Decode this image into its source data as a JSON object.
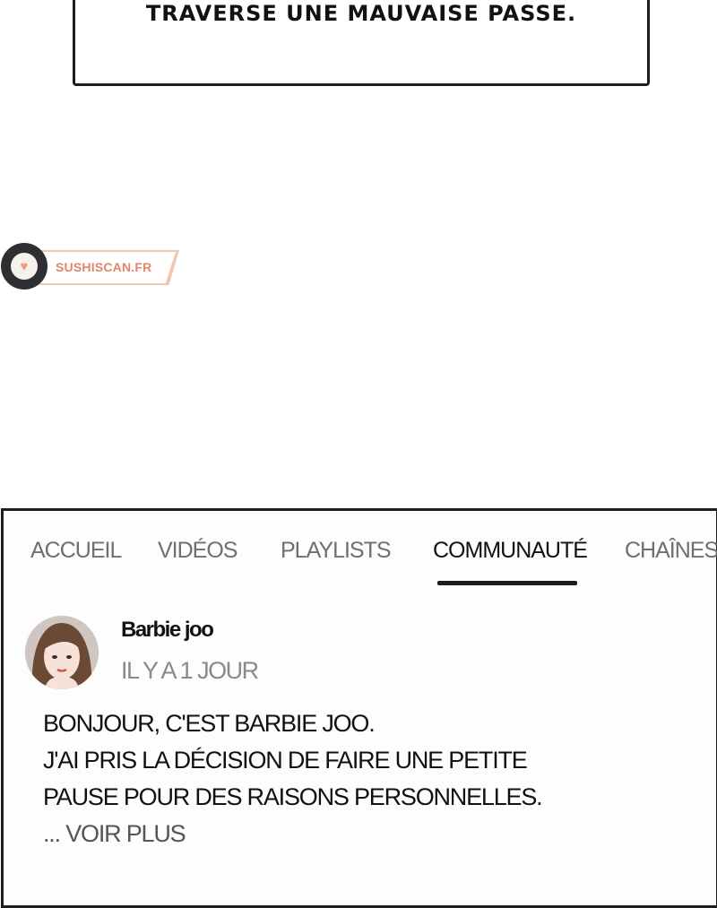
{
  "speech_box": {
    "text": "TRAVERSE UNE MAUVAISE PASSE."
  },
  "watermark": {
    "label": "SUSHISCAN.FR",
    "icon": "heart-icon"
  },
  "community": {
    "tabs": [
      {
        "label": "ACCUEIL",
        "active": false
      },
      {
        "label": "VIDÉOS",
        "active": false
      },
      {
        "label": "PLAYLISTS",
        "active": false
      },
      {
        "label": "COMMUNAUTÉ",
        "active": true
      },
      {
        "label": "CHAÎNES",
        "active": false
      }
    ],
    "post": {
      "author": "Barbie joo",
      "timestamp": "IL Y A 1 JOUR",
      "lines": [
        "BONJOUR, C'EST BARBIE JOO.",
        "J'AI PRIS LA DÉCISION DE FAIRE UNE PETITE",
        "PAUSE POUR DES RAISONS PERSONNELLES."
      ],
      "see_more": "... VOIR PLUS"
    }
  }
}
